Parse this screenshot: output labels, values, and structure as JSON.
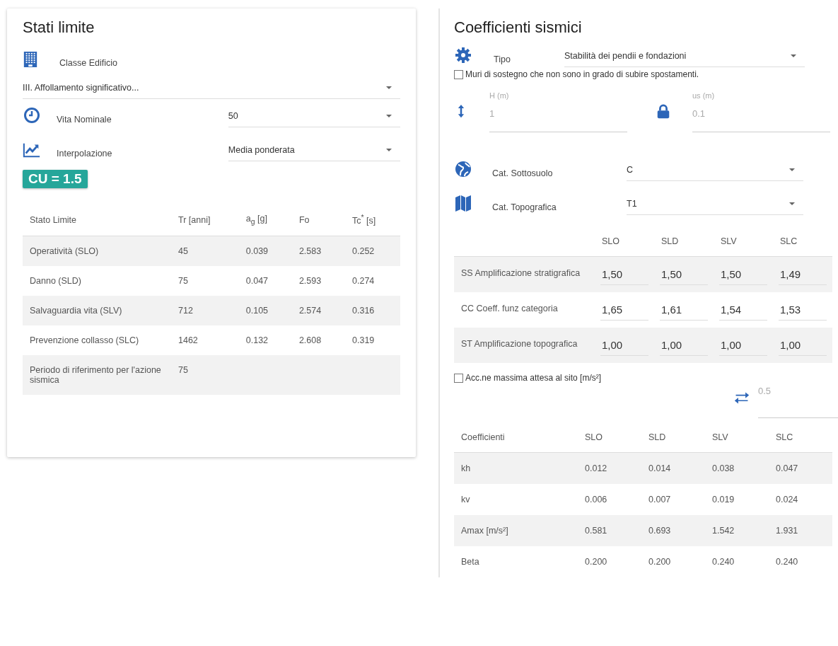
{
  "stati_limite": {
    "title": "Stati limite",
    "classe_edificio": {
      "label": "Classe Edificio",
      "value": "III. Affollamento significativo..."
    },
    "vita_nominale": {
      "label": "Vita Nominale",
      "value": "50"
    },
    "interpolazione": {
      "label": "Interpolazione",
      "value": "Media ponderata"
    },
    "cu_badge": "CU = 1.5",
    "table": {
      "columns": [
        "Stato Limite",
        "Tr [anni]",
        "a$_{g}$ [g]",
        "Fo",
        "Tc$^{*}$ [s]"
      ],
      "rows": [
        [
          "Operatività (SLO)",
          "45",
          "0.039",
          "2.583",
          "0.252"
        ],
        [
          "Danno (SLD)",
          "75",
          "0.047",
          "2.593",
          "0.274"
        ],
        [
          "Salvaguardia vita (SLV)",
          "712",
          "0.105",
          "2.574",
          "0.316"
        ],
        [
          "Prevenzione collasso (SLC)",
          "1462",
          "0.132",
          "2.608",
          "0.319"
        ],
        [
          "Periodo di riferimento per l'azione sismica",
          "75"
        ]
      ]
    }
  },
  "coefficienti_sismici": {
    "title": "Coefficienti sismici",
    "tipo": {
      "label": "Tipo",
      "value": "Stabilità dei pendii e fondazioni"
    },
    "muri_checkbox": {
      "label": "Muri di sostegno che non sono in grado di subire spostamenti.",
      "checked": false
    },
    "h_field": {
      "label": "H (m)",
      "value": "1",
      "disabled": true
    },
    "us_field": {
      "label": "us (m)",
      "value": "0.1",
      "disabled": true
    },
    "cat_sottosuolo": {
      "label": "Cat. Sottosuolo",
      "value": "C"
    },
    "cat_topografica": {
      "label": "Cat. Topografica",
      "value": "T1"
    },
    "amplification_table": {
      "columns": [
        "SLO",
        "SLD",
        "SLV",
        "SLC"
      ],
      "rows": [
        {
          "label": "SS Amplificazione stratigrafica",
          "values": [
            "1,50",
            "1,50",
            "1,50",
            "1,49"
          ]
        },
        {
          "label": "CC Coeff. funz categoria",
          "values": [
            "1,65",
            "1,61",
            "1,54",
            "1,53"
          ]
        },
        {
          "label": "ST Amplificazione topografica",
          "values": [
            "1,00",
            "1,00",
            "1,00",
            "1,00"
          ]
        }
      ]
    },
    "acc_checkbox": {
      "label": "Acc.ne massima attesa al sito [m/s²]",
      "checked": false
    },
    "acc_field": {
      "value": "0.5",
      "disabled": true
    },
    "coefficients_table": {
      "columns": [
        "Coefficienti",
        "SLO",
        "SLD",
        "SLV",
        "SLC"
      ],
      "rows": [
        [
          "kh",
          "0.012",
          "0.014",
          "0.038",
          "0.047"
        ],
        [
          "kv",
          "0.006",
          "0.007",
          "0.019",
          "0.024"
        ],
        [
          "Amax [m/s²]",
          "0.581",
          "0.693",
          "1.542",
          "1.931"
        ],
        [
          "Beta",
          "0.200",
          "0.200",
          "0.240",
          "0.240"
        ]
      ]
    }
  }
}
